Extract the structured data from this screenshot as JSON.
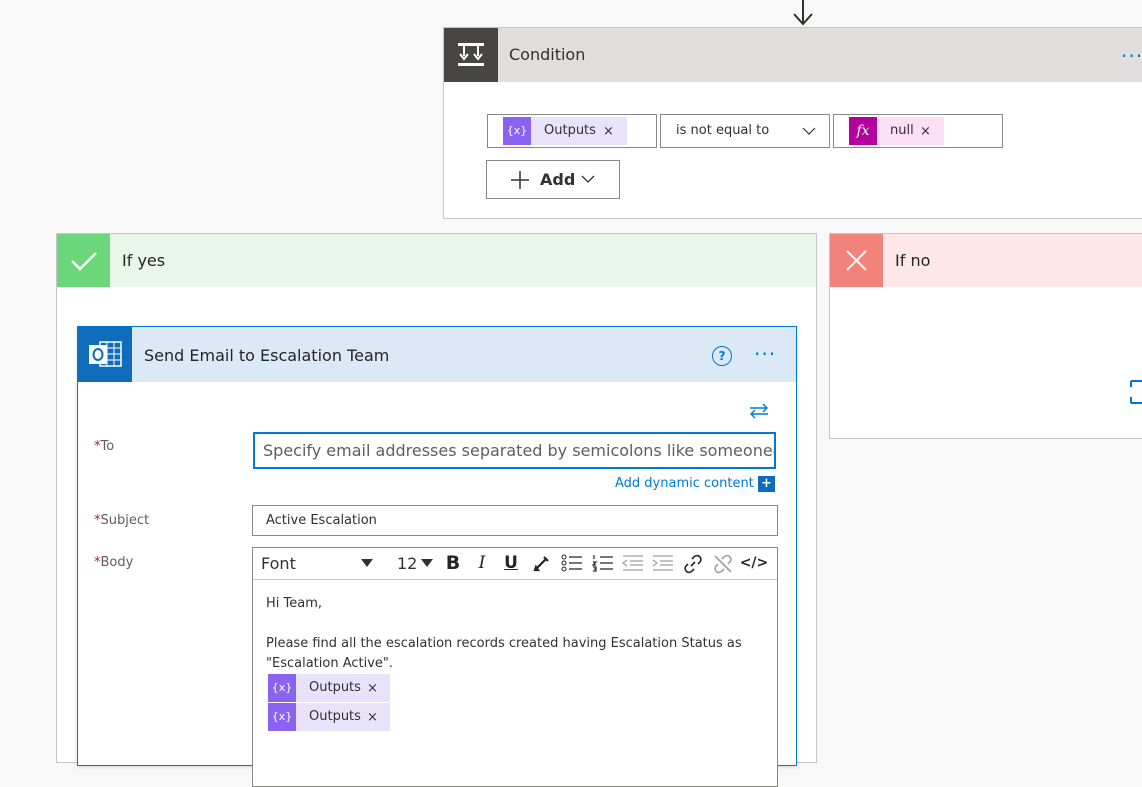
{
  "condition": {
    "title": "Condition",
    "more": "···",
    "left_token": {
      "icon": "{x}",
      "label": "Outputs",
      "remove": "×"
    },
    "operator": "is not equal to",
    "right_token": {
      "icon": "fx",
      "label": "null",
      "remove": "×"
    },
    "add_label": "Add"
  },
  "if_yes": {
    "title": "If yes"
  },
  "if_no": {
    "title": "If no"
  },
  "email": {
    "title": "Send Email to Escalation Team",
    "help": "?",
    "more": "···",
    "to_label": "To",
    "to_placeholder": "Specify email addresses separated by semicolons like someone@con",
    "add_dynamic_content": "Add dynamic content",
    "subject_label": "Subject",
    "subject_value": "Active Escalation",
    "body_label": "Body",
    "required_marker": "*",
    "toolbar": {
      "font": "Font",
      "size": "12",
      "bold": "B",
      "italic": "I",
      "underline": "U",
      "code": "</>"
    },
    "body": {
      "line1": "Hi Team,",
      "line2": "Please find all the escalation records created having Escalation Status as",
      "line3": "\"Escalation Active\".",
      "tokens": [
        {
          "icon": "{x}",
          "label": "Outputs",
          "remove": "×"
        },
        {
          "icon": "{x}",
          "label": "Outputs",
          "remove": "×"
        }
      ]
    }
  },
  "colors": {
    "accent": "#0078d4",
    "token_bg": "#e9e2fb",
    "token_icon": "#8a63f3",
    "fx_icon": "#b4009e",
    "yes": "#6cd67a",
    "no": "#f1837b"
  }
}
